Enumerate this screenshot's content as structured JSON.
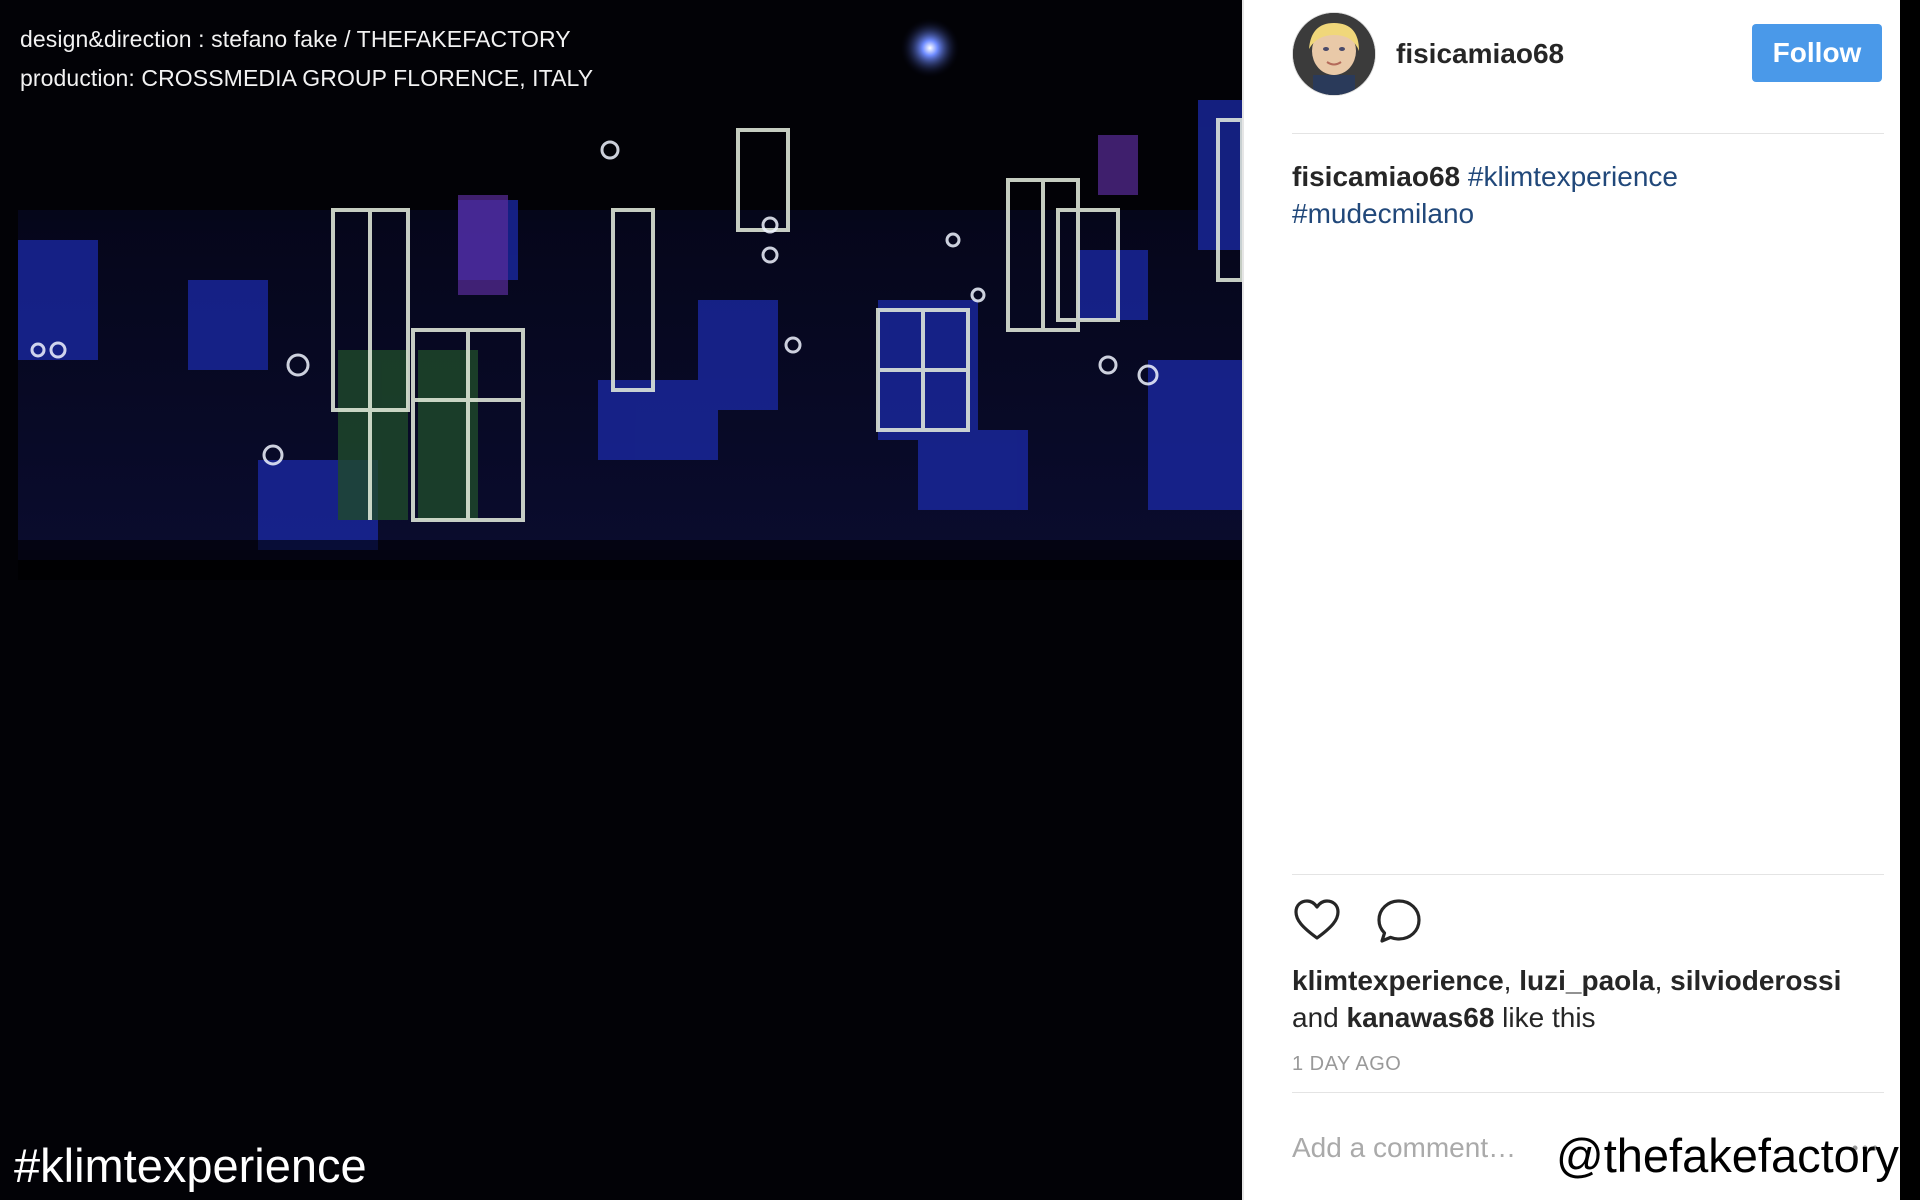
{
  "credits": {
    "line1": "design&direction : stefano fake / THEFAKEFACTORY",
    "line2": "production: CROSSMEDIA GROUP FLORENCE, ITALY"
  },
  "overlay": {
    "hashtag": "#klimtexperience",
    "watermark": "@thefakefactory"
  },
  "post": {
    "username": "fisicamiao68",
    "follow_label": "Follow",
    "caption": {
      "user": "fisicamiao68",
      "tags": [
        "#klimtexperience",
        "#mudecmilano"
      ]
    },
    "likes": {
      "names": [
        "klimtexperience",
        "luzi_paola",
        "silvioderossi"
      ],
      "and_text": "and",
      "last_name": "kanawas68",
      "suffix": "like this"
    },
    "timestamp": "1 DAY AGO",
    "comment_placeholder": "Add a comment…"
  },
  "icons": {
    "like": "heart-icon",
    "comment": "speech-bubble-icon",
    "more": "more-options-icon"
  },
  "colors": {
    "follow_button": "#4a99e9",
    "hashtag_link": "#21487a",
    "timestamp": "#999999"
  }
}
